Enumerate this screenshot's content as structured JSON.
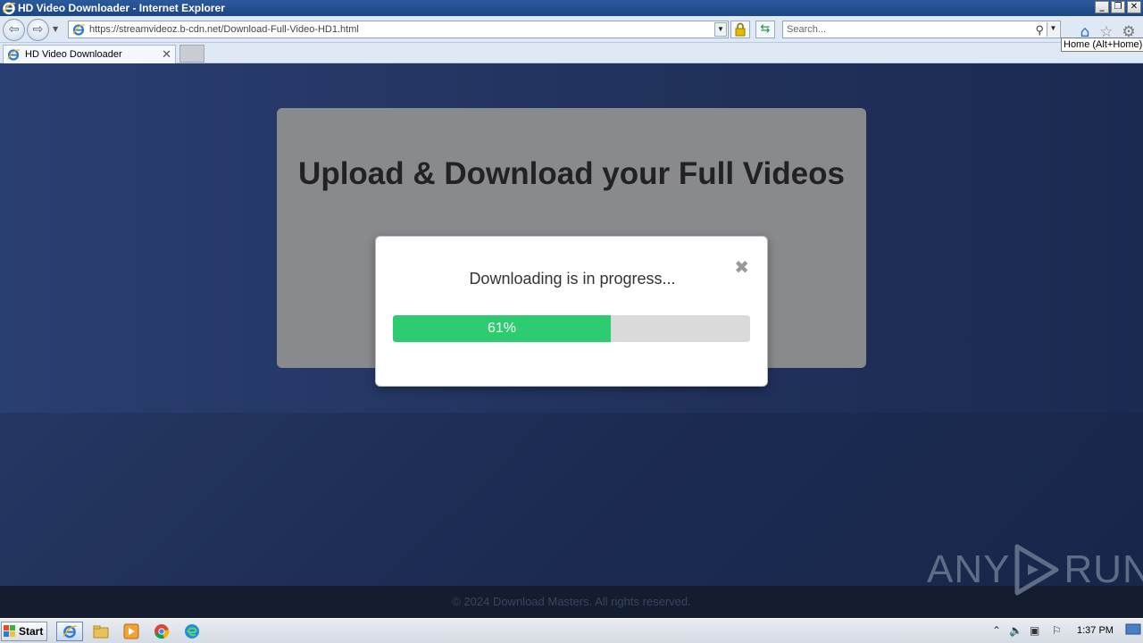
{
  "window": {
    "title": "HD Video Downloader - Internet Explorer",
    "controls": [
      "_",
      "❐",
      "✕"
    ]
  },
  "navbar": {
    "url": "https://streamvideoz.b-cdn.net/Download-Full-Video-HD1.html",
    "search_placeholder": "Search...",
    "home_tooltip": "Home (Alt+Home)"
  },
  "tabs": [
    {
      "label": "HD Video Downloader",
      "active": true
    }
  ],
  "page": {
    "heading": "Upload & Download your Full Videos",
    "footer": "© 2024 Download Masters. All rights reserved."
  },
  "modal": {
    "message": "Downloading is in progress...",
    "close_symbol": "✖",
    "progress_percent": 61,
    "progress_label": "61%"
  },
  "watermark": {
    "left": "ANY",
    "right": "RUN"
  },
  "taskbar": {
    "start_label": "Start",
    "clock": "1:37 PM",
    "apps": [
      "internet-explorer",
      "file-explorer",
      "media-player",
      "chrome",
      "edge"
    ]
  },
  "colors": {
    "progress_fill": "#2ecc71",
    "progress_track": "#dadada",
    "card_bg": "#888a8e",
    "page_bg": "#22335f"
  }
}
